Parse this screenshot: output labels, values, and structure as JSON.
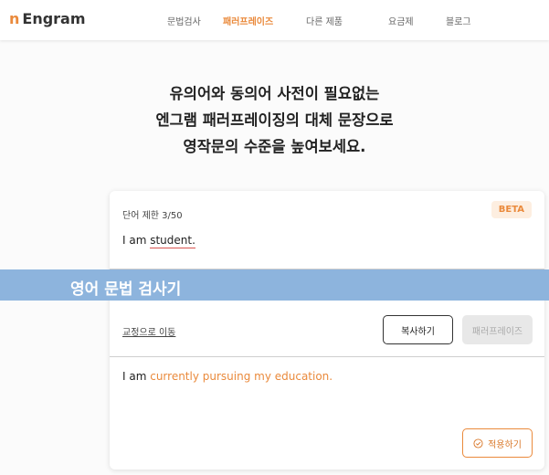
{
  "header": {
    "logo_mark": "n",
    "logo_text": "Engram",
    "nav": [
      {
        "label": "문법검사",
        "active": false
      },
      {
        "label": "패러프레이즈",
        "active": true
      },
      {
        "label": "다른 제품",
        "active": false
      },
      {
        "label": "요금제",
        "active": false
      },
      {
        "label": "블로그",
        "active": false
      }
    ]
  },
  "hero": {
    "line1": "유의어와 동의어 사전이 필요없는",
    "line2": "엔그램 패러프레이징의 대체 문장으로",
    "line3": "영작문의 수준을 높여보세요."
  },
  "editor": {
    "word_limit": "단어 제한 3/50",
    "badge": "BETA",
    "input_prefix": "I am ",
    "input_error_word": "student.",
    "goto_fix_link": "교정으로 이동",
    "copy_button": "복사하기",
    "paraphrase_button": "패러프레이즈",
    "result_prefix": "I am ",
    "result_highlight": "currently pursuing my education.",
    "apply_button": "적용하기"
  },
  "banner": {
    "text": "영어 문법 검사기"
  },
  "colors": {
    "accent": "#ea8a3c",
    "error_underline": "#d9534f",
    "banner_bg": "#8db4dd"
  },
  "icons": {
    "apply": "check-circle-icon"
  }
}
